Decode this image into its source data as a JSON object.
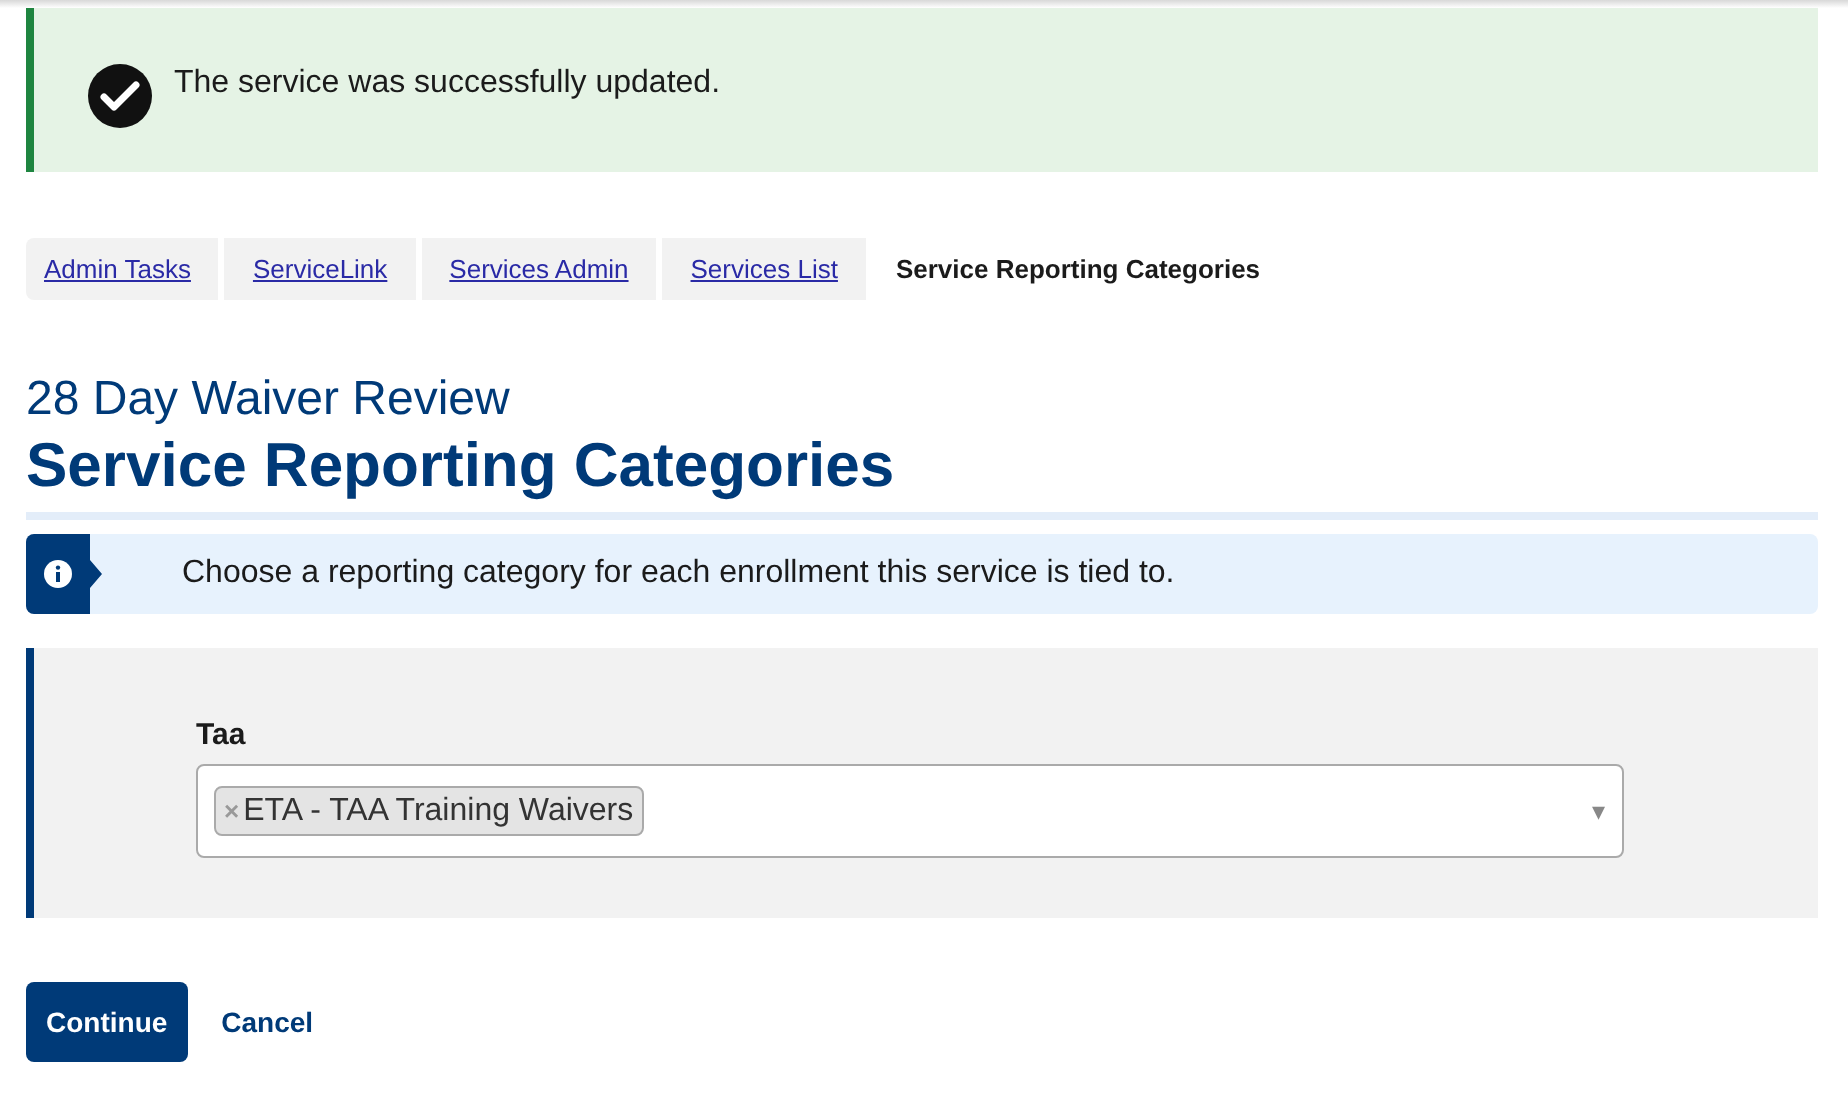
{
  "alert": {
    "kind": "success",
    "message": "The service was successfully updated."
  },
  "breadcrumbs": [
    {
      "label": "Admin Tasks",
      "kind": "link"
    },
    {
      "label": "ServiceLink",
      "kind": "link"
    },
    {
      "label": "Services Admin",
      "kind": "link"
    },
    {
      "label": "Services List",
      "kind": "link"
    },
    {
      "label": "Service Reporting Categories",
      "kind": "current"
    }
  ],
  "subtitle": "28 Day Waiver Review",
  "title": "Service Reporting Categories",
  "info": "Choose a reporting category for each enrollment this service is tied to.",
  "fields": [
    {
      "label": "Taa",
      "tags": [
        {
          "remove": "×",
          "label": "ETA - TAA Training Waivers"
        }
      ],
      "arrow": "▾"
    }
  ],
  "buttons": [
    {
      "label": "Continue",
      "kind": "primary"
    },
    {
      "label": "Cancel",
      "kind": "link"
    }
  ]
}
